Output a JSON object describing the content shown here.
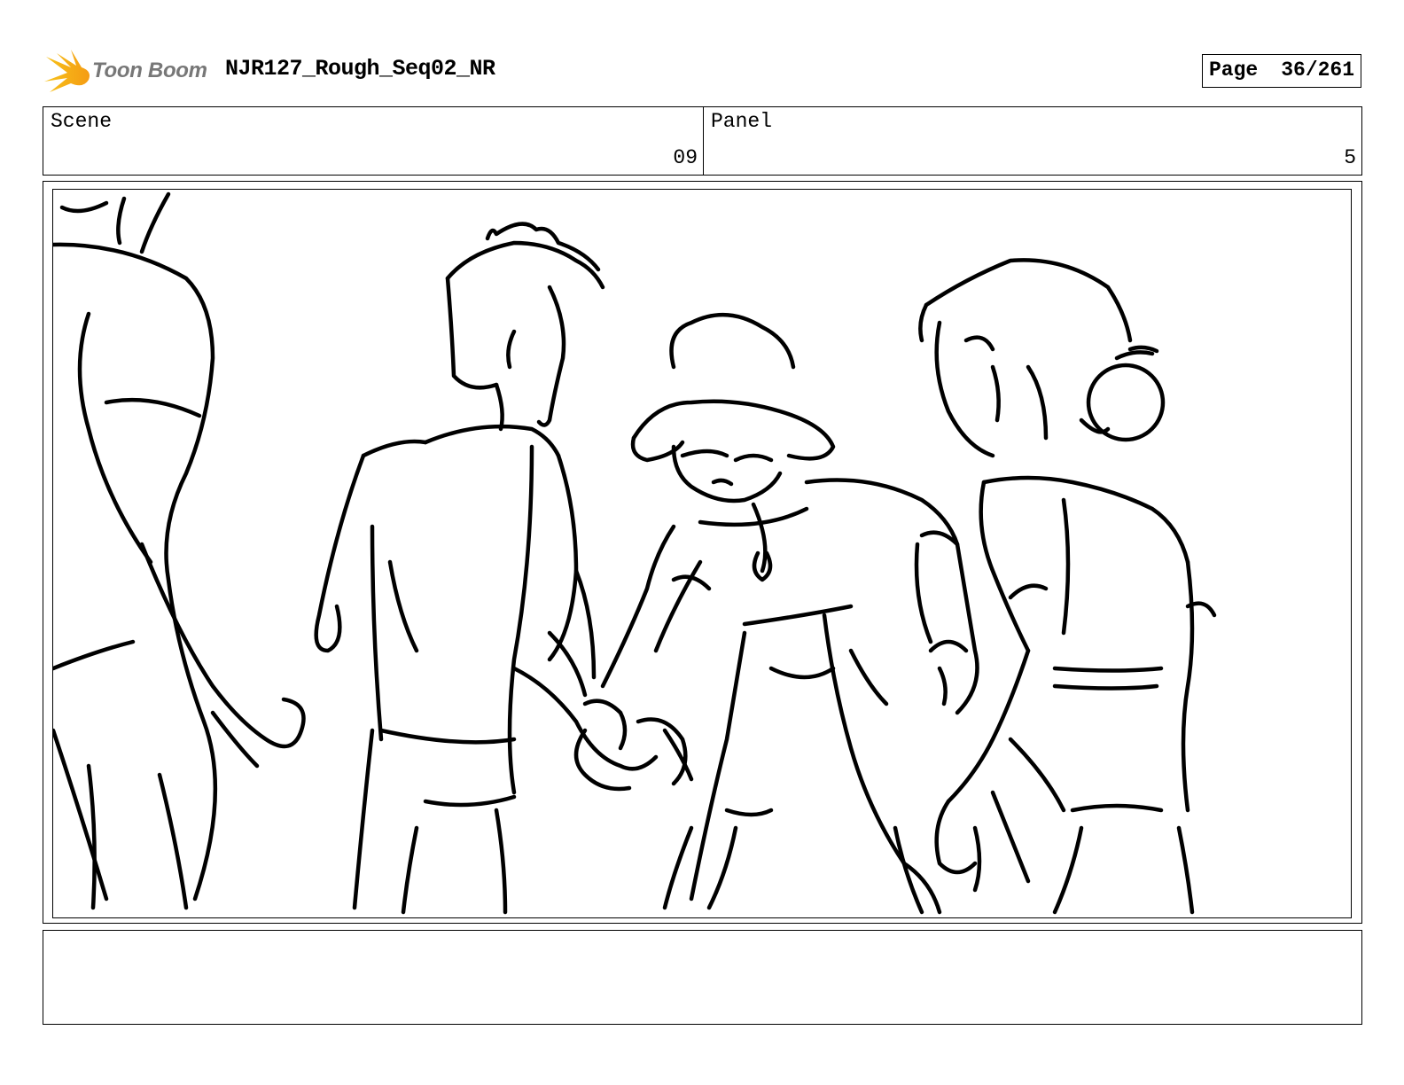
{
  "header": {
    "logo_text": "Toon Boom",
    "project_title": "NJR127_Rough_Seq02_NR",
    "page_label": "Page",
    "page_number": "36/261"
  },
  "info": {
    "scene_label": "Scene",
    "scene_value": "09",
    "panel_label": "Panel",
    "panel_value": "5"
  },
  "notes": {
    "text": ""
  }
}
